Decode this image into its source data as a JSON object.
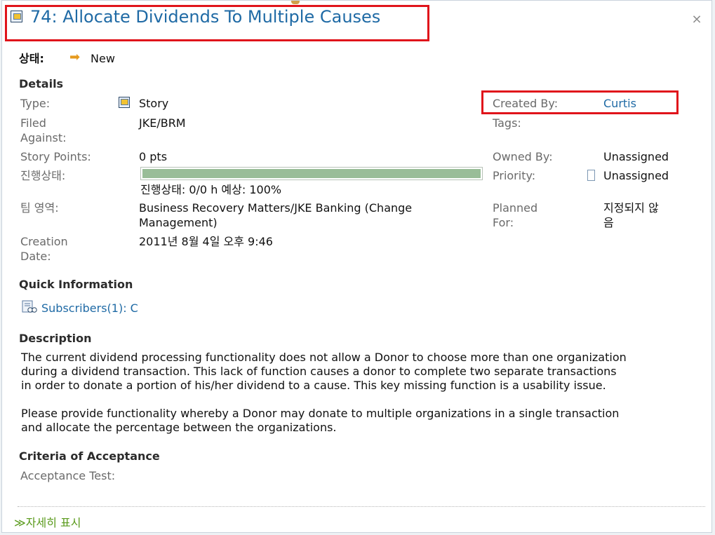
{
  "header": {
    "title": "74: Allocate Dividends To Multiple Causes",
    "close_icon": "close-icon"
  },
  "status": {
    "label": "상태:",
    "value": "New",
    "icon": "arrow-right-icon"
  },
  "details": {
    "heading": "Details",
    "type_label": "Type:",
    "type_value": "Story",
    "filed_against_label_1": "Filed",
    "filed_against_label_2": "Against:",
    "filed_against_value": "JKE/BRM",
    "story_points_label": "Story Points:",
    "story_points_value": "0 pts",
    "progress_label": "진행상태:",
    "progress_text": "진행상태: 0/0 h 예상: 100%",
    "progress_fraction": 1.0,
    "team_area_label": "팀 영역:",
    "team_area_value_1": "Business Recovery Matters/JKE Banking (Change",
    "team_area_value_2": "Management)",
    "creation_date_label_1": "Creation",
    "creation_date_label_2": "Date:",
    "creation_date_value": "2011년 8월 4일 오후 9:46",
    "created_by_label": "Created By:",
    "created_by_value": "Curtis",
    "tags_label": "Tags:",
    "owned_by_label": "Owned By:",
    "owned_by_value": "Unassigned",
    "priority_label": "Priority:",
    "priority_value": "Unassigned",
    "planned_for_label_1": "Planned",
    "planned_for_label_2": "For:",
    "planned_for_value_1": "지정되지 않",
    "planned_for_value_2": "음"
  },
  "quick_information": {
    "heading": "Quick Information",
    "subscribers": "Subscribers(1): C"
  },
  "description": {
    "heading": "Description",
    "para1_line1": "The current dividend processing functionality does not allow a Donor to choose more than one organization",
    "para1_line2": "during a dividend transaction. This lack of function causes a donor to complete two separate transactions",
    "para1_line3": "in order to donate a portion of his/her dividend to a cause. This key missing function is a usability issue.",
    "para2_line1": "Please provide functionality whereby a Donor may donate to multiple organizations in a single transaction",
    "para2_line2": "and allocate the percentage between the organizations."
  },
  "criteria": {
    "heading": "Criteria of Acceptance",
    "acceptance_test_label": "Acceptance Test:"
  },
  "footer": {
    "show_more": "자세히 표시"
  },
  "colors": {
    "link": "#1f6aa5",
    "highlight_border": "#e0141b",
    "progress_fill": "#99bd98",
    "show_more": "#5a9a1c"
  }
}
